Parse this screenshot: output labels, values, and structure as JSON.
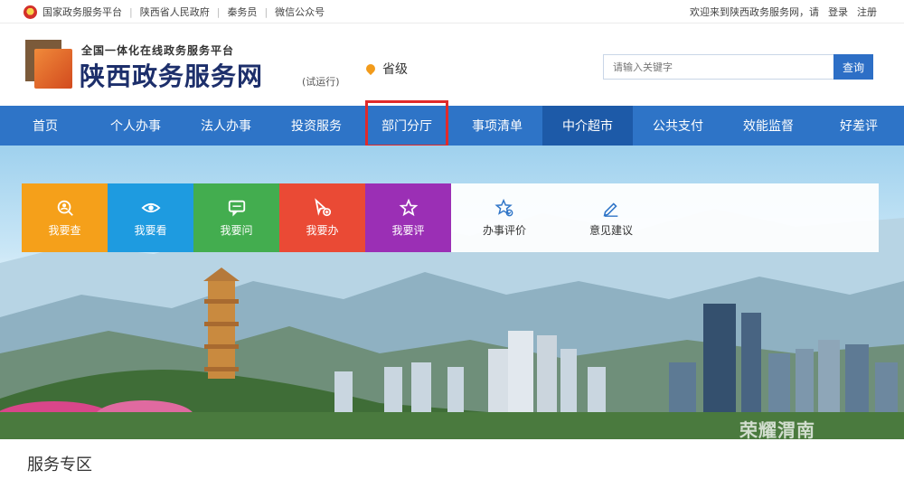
{
  "topbar": {
    "links": [
      "国家政务服务平台",
      "陕西省人民政府",
      "秦务员",
      "微信公众号"
    ],
    "welcome": "欢迎来到陕西政务服务网，请",
    "login": "登录",
    "register": "注册"
  },
  "header": {
    "subtitle": "全国一体化在线政务服务平台",
    "title": "陕西政务服务网",
    "trial": "(试运行)",
    "region": "省级",
    "search_placeholder": "请输入关键字",
    "search_button": "查询"
  },
  "nav": {
    "items": [
      "首页",
      "个人办事",
      "法人办事",
      "投资服务",
      "部门分厅",
      "事项清单",
      "中介超市",
      "公共支付",
      "效能监督",
      "好差评"
    ],
    "active_index": 6,
    "highlight_index": 4
  },
  "quick": {
    "tiles": [
      {
        "label": "我要查",
        "color": "#f5a01a",
        "icon": "search-person-icon"
      },
      {
        "label": "我要看",
        "color": "#1e9be0",
        "icon": "eye-icon"
      },
      {
        "label": "我要问",
        "color": "#43ad4f",
        "icon": "chat-icon"
      },
      {
        "label": "我要办",
        "color": "#ea4a35",
        "icon": "cursor-plus-icon"
      },
      {
        "label": "我要评",
        "color": "#9b2fb5",
        "icon": "star-icon"
      }
    ],
    "extra": [
      {
        "label": "办事评价",
        "icon": "star-check-icon"
      },
      {
        "label": "意见建议",
        "icon": "pencil-icon"
      }
    ]
  },
  "watermark": "荣耀渭南",
  "section_title": "服务专区",
  "colors": {
    "nav_bg": "#2e74c7",
    "nav_active": "#1d5aa8",
    "highlight_border": "#e02a2a",
    "search_button": "#2d6fc6"
  }
}
